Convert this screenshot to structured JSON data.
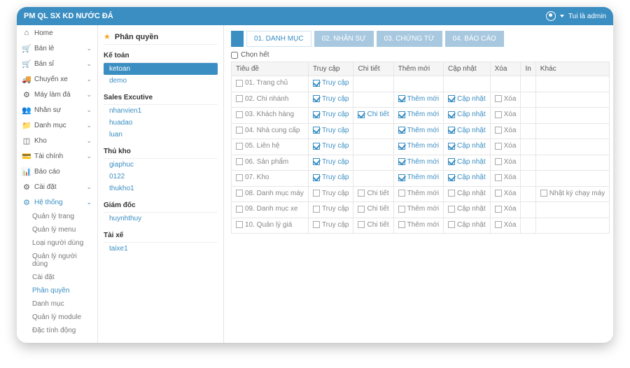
{
  "app": {
    "title": "PM QL SX KD NƯỚC ĐÁ"
  },
  "userarea": {
    "label": "Tui là admin"
  },
  "sidebar": {
    "items": [
      {
        "icon": "home",
        "label": "Home",
        "expand": false
      },
      {
        "icon": "cart",
        "label": "Bán lẻ",
        "expand": true
      },
      {
        "icon": "cart",
        "label": "Bán sỉ",
        "expand": true
      },
      {
        "icon": "truck",
        "label": "Chuyến xe",
        "expand": true
      },
      {
        "icon": "cog",
        "label": "Máy làm đá",
        "expand": true
      },
      {
        "icon": "users",
        "label": "Nhân sự",
        "expand": true
      },
      {
        "icon": "folder",
        "label": "Danh mục",
        "expand": true
      },
      {
        "icon": "box",
        "label": "Kho",
        "expand": true
      },
      {
        "icon": "wallet",
        "label": "Tài chính",
        "expand": true
      },
      {
        "icon": "chart",
        "label": "Báo cáo",
        "expand": false
      },
      {
        "icon": "gear",
        "label": "Cài đặt",
        "expand": true
      }
    ],
    "system_label": "Hệ thống",
    "subs": [
      "Quản lý trang",
      "Quản lý menu",
      "Loại người dùng",
      "Quản lý người dùng",
      "Cài đặt",
      "Phân quyền",
      "Danh mục",
      "Quản lý module",
      "Đặc tính động"
    ],
    "active_sub": "Phân quyền"
  },
  "roles": {
    "title": "Phân quyền",
    "groups": [
      {
        "name": "Kế toán",
        "users": [
          "ketoan",
          "demo"
        ],
        "selected": "ketoan"
      },
      {
        "name": "Sales Excutive",
        "users": [
          "nhanvien1",
          "huadao",
          "luan"
        ]
      },
      {
        "name": "Thủ kho",
        "users": [
          "giaphuc",
          "0122",
          "thukho1"
        ]
      },
      {
        "name": "Giám đốc",
        "users": [
          "huynhthuy"
        ]
      },
      {
        "name": "Tài xế",
        "users": [
          "taixe1"
        ]
      }
    ]
  },
  "tabs": [
    {
      "label": "01. DANH MỤC",
      "active": true
    },
    {
      "label": "02. NHÂN SỰ"
    },
    {
      "label": "03. CHỨNG TỪ"
    },
    {
      "label": "04. BÁO CÁO"
    }
  ],
  "select_all": "Chọn hết",
  "columns": [
    "Tiêu đề",
    "Truy cập",
    "Chi tiết",
    "Thêm mới",
    "Cập nhật",
    "Xóa",
    "In",
    "Khác"
  ],
  "perm_labels": {
    "truycap": "Truy cập",
    "chitiet": "Chi tiết",
    "themmoi": "Thêm mới",
    "capnhat": "Cập nhật",
    "xoa": "Xóa",
    "khac": "Nhật ký chạy máy"
  },
  "rows": [
    {
      "title": "01. Trang chủ",
      "truycap": true
    },
    {
      "title": "02. Chi nhánh",
      "truycap": true,
      "themmoi": true,
      "capnhat": true,
      "xoa": false
    },
    {
      "title": "03. Khách hàng",
      "truycap": true,
      "chitiet": true,
      "themmoi": true,
      "capnhat": true,
      "xoa": false
    },
    {
      "title": "04. Nhà cung cấp",
      "truycap": true,
      "themmoi": true,
      "capnhat": true,
      "xoa": false
    },
    {
      "title": "05. Liên hệ",
      "truycap": true,
      "themmoi": true,
      "capnhat": true,
      "xoa": false
    },
    {
      "title": "06. Sản phẩm",
      "truycap": true,
      "themmoi": true,
      "capnhat": true,
      "xoa": false
    },
    {
      "title": "07. Kho",
      "truycap": true,
      "themmoi": true,
      "capnhat": true,
      "xoa": false
    },
    {
      "title": "08. Danh mục máy",
      "truycap": false,
      "chitiet": false,
      "themmoi": false,
      "capnhat": false,
      "xoa": false,
      "khac": false
    },
    {
      "title": "09. Danh mục xe",
      "truycap": false,
      "chitiet": false,
      "themmoi": false,
      "capnhat": false,
      "xoa": false
    },
    {
      "title": "10. Quản lý giá",
      "truycap": false,
      "chitiet": false,
      "themmoi": false,
      "capnhat": false,
      "xoa": false
    }
  ]
}
